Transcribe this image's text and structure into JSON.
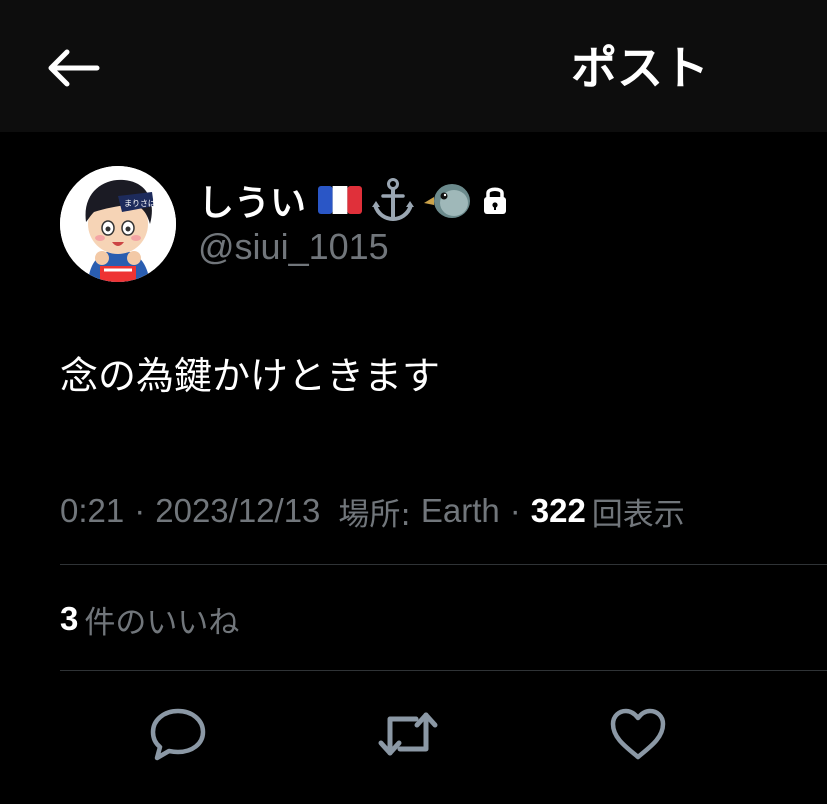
{
  "header": {
    "back_icon": "arrow-left-icon",
    "title": "ポスト"
  },
  "author": {
    "display_name": "しうい",
    "name_emojis": [
      "france-flag-icon",
      "anchor-icon",
      "bird-icon"
    ],
    "protected_icon": "lock-icon",
    "handle": "@siui_1015",
    "avatar_badge_text": "まりさば"
  },
  "tweet": {
    "text": "念の為鍵かけときます"
  },
  "meta": {
    "time": "0:21",
    "separator": "·",
    "date": "2023/12/13",
    "location_label": "場所:",
    "location": "Earth",
    "views_count": "322",
    "views_label": "回表示"
  },
  "likes": {
    "count": "3",
    "label": "件のいいね"
  },
  "actions": [
    "reply-icon",
    "retweet-icon",
    "like-icon"
  ],
  "colors": {
    "background": "#000000",
    "header_background": "#0d0d0d",
    "secondary_text": "#71767b",
    "divider": "#2f3336",
    "icon": "#8b98a5"
  }
}
